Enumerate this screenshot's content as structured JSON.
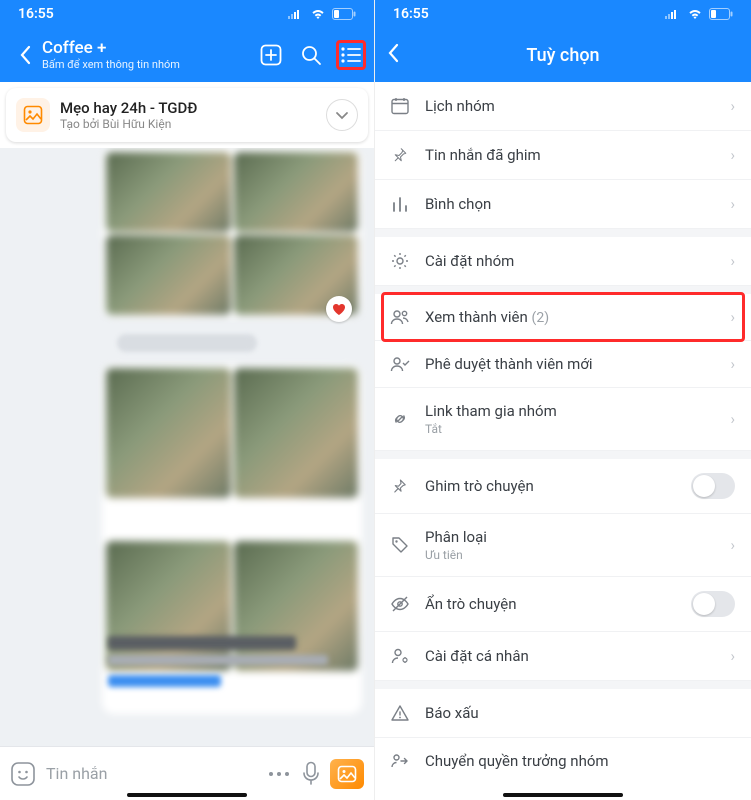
{
  "status": {
    "time": "16:55"
  },
  "left": {
    "header": {
      "title": "Coffee +",
      "subtitle": "Bấm để xem thông tin nhóm"
    },
    "pinned": {
      "title": "Mẹo hay 24h - TGDĐ",
      "subtitle": "Tạo bởi Bùi Hữu Kiện"
    },
    "input_placeholder": "Tin nhắn"
  },
  "right": {
    "title": "Tuỳ chọn",
    "items": {
      "calendar": "Lịch nhóm",
      "pinned_msgs": "Tin nhắn đã ghim",
      "poll": "Bình chọn",
      "group_settings": "Cài đặt nhóm",
      "members": "Xem thành viên",
      "members_count": "(2)",
      "approve": "Phê duyệt thành viên mới",
      "link": "Link tham gia nhóm",
      "link_sub": "Tắt",
      "pin_chat": "Ghim trò chuyện",
      "category": "Phân loại",
      "category_sub": "Ưu tiên",
      "hide": "Ẩn trò chuyện",
      "personal": "Cài đặt cá nhân",
      "report": "Báo xấu",
      "transfer": "Chuyển quyền trưởng nhóm"
    }
  }
}
